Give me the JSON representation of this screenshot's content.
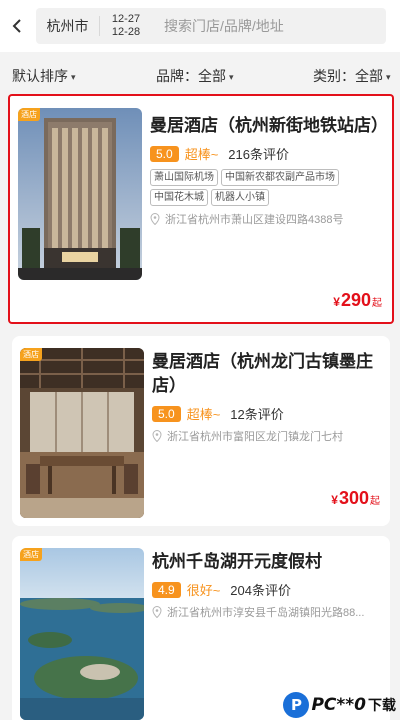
{
  "header": {
    "back_icon": "chevron-left-icon",
    "city": "杭州市",
    "checkin": "12-27",
    "checkout": "12-28",
    "search_placeholder": "搜索门店/品牌/地址"
  },
  "filters": {
    "sort": "默认排序",
    "brand": "品牌：全部",
    "type": "类别：全部"
  },
  "colors": {
    "accent_orange": "#f7931e",
    "price_red": "#e3101a",
    "highlight_border": "#e3101a"
  },
  "hotels": [
    {
      "badge": "酒店",
      "name": "曼居酒店（杭州新街地铁站店）",
      "score": "5.0",
      "score_word": "超棒~",
      "reviews": "216条评价",
      "chips": [
        "萧山国际机场",
        "中国新农都农副产品市场",
        "中国花木城",
        "机器人小镇"
      ],
      "address": "浙江省杭州市萧山区建设四路4388号",
      "price_symbol": "¥",
      "price": "290",
      "price_suffix": "起",
      "highlighted": true
    },
    {
      "badge": "酒店",
      "name": "曼居酒店（杭州龙门古镇墨庄店）",
      "score": "5.0",
      "score_word": "超棒~",
      "reviews": "12条评价",
      "chips": [],
      "address": "浙江省杭州市富阳区龙门镇龙门七村",
      "price_symbol": "¥",
      "price": "300",
      "price_suffix": "起",
      "highlighted": false
    },
    {
      "badge": "酒店",
      "name": "杭州千岛湖开元度假村",
      "score": "4.9",
      "score_word": "很好~",
      "reviews": "204条评价",
      "chips": [],
      "address": "浙江省杭州市淳安县千岛湖镇阳光路88...",
      "price_symbol": "¥",
      "price": "",
      "price_suffix": "",
      "highlighted": false
    }
  ],
  "watermark": {
    "logo": "P",
    "text": "PC**0",
    "suffix": "下载"
  }
}
